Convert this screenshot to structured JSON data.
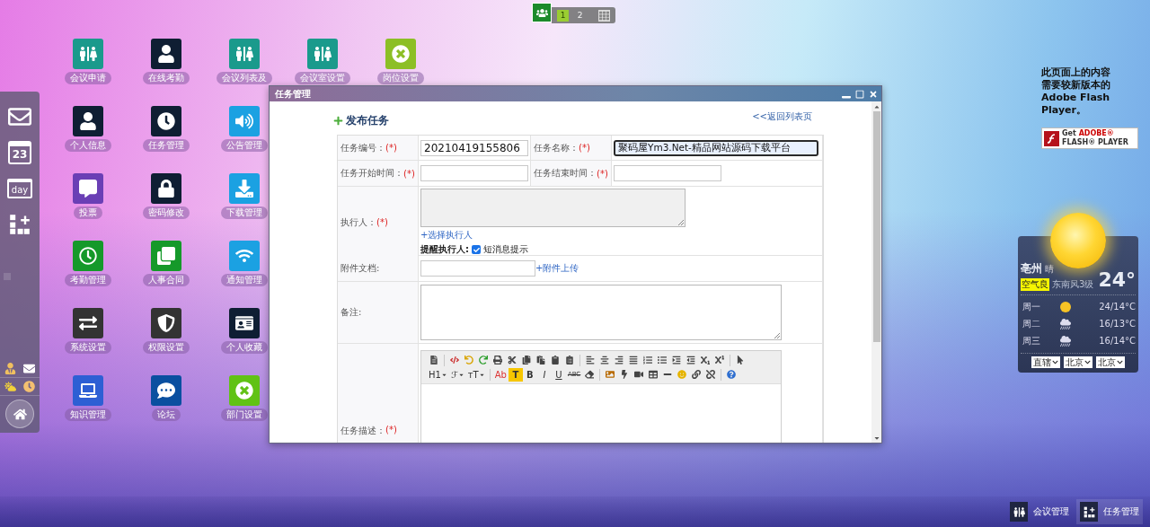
{
  "pager": {
    "pages": [
      {
        "label": "1",
        "selected": true
      },
      {
        "label": "2",
        "selected": false
      }
    ]
  },
  "desktop_icons": [
    {
      "icons": [
        {
          "label": "会议申请",
          "color": "#1a9a8c"
        },
        {
          "label": "在线考勤",
          "color": "#0f1e33"
        },
        {
          "label": "会议列表及",
          "color": "#1a9a8c"
        },
        {
          "label": "会议室设置",
          "color": "#1a9a8c"
        },
        {
          "label": "岗位设置",
          "color": "#8cbf26"
        }
      ]
    },
    {
      "icons": [
        {
          "label": "个人信息",
          "color": "#0f1e33"
        },
        {
          "label": "任务管理",
          "color": "#0f1e33"
        },
        {
          "label": "公告管理",
          "color": "#1ba1e2"
        }
      ]
    },
    {
      "icons": [
        {
          "label": "投票",
          "color": "#6a3fb5"
        },
        {
          "label": "密码修改",
          "color": "#0f1e33"
        },
        {
          "label": "下载管理",
          "color": "#1ba1e2"
        }
      ]
    },
    {
      "icons": [
        {
          "label": "考勤管理",
          "color": "#15992a"
        },
        {
          "label": "人事合同",
          "color": "#15992a"
        },
        {
          "label": "通知管理",
          "color": "#1ba1e2"
        }
      ]
    },
    {
      "icons": [
        {
          "label": "系统设置",
          "color": "#333333"
        },
        {
          "label": "权限设置",
          "color": "#333333"
        },
        {
          "label": "个人收藏",
          "color": "#0f1e33"
        }
      ]
    },
    {
      "icons": [
        {
          "label": "知识管理",
          "color": "#2d5fd4"
        },
        {
          "label": "论坛",
          "color": "#0a4fa0"
        },
        {
          "label": "部门设置",
          "color": "#61c215"
        }
      ]
    }
  ],
  "dock": {
    "calendar_date": "23",
    "day_label": "day"
  },
  "window": {
    "title": "任务管理",
    "heading": "发布任务",
    "back_link": "<<返回列表页",
    "form": {
      "rows": [
        {
          "kind": "pair",
          "fields": [
            {
              "label": "任务编号：",
              "mark": "(*)",
              "value": "20210419155806",
              "focused": false
            },
            {
              "label": "任务名称：",
              "mark": "(*)",
              "value": "聚码屋Ym3.Net-精品网站源码下载平台",
              "focused": true
            }
          ]
        },
        {
          "kind": "pair",
          "fields": [
            {
              "label": "任务开始时间：",
              "mark": "(*)",
              "focused": false
            },
            {
              "label": "任务结束时间：",
              "mark": "(*)",
              "focused": false
            }
          ]
        },
        {
          "kind": "assignee",
          "label": "执行人：",
          "mark": "(*)",
          "disabled": true,
          "link": "+选择执行人",
          "remind_label": "提醒执行人:",
          "option": {
            "label": "短消息提示",
            "checked": true
          }
        },
        {
          "kind": "upload",
          "label": "附件文档:",
          "link": "+附件上传"
        },
        {
          "kind": "textarea",
          "label": "备注:"
        },
        {
          "kind": "editor",
          "label": "任务描述：",
          "mark": "(*)",
          "toolbar": [
            [
              {
                "kind": "icon"
              },
              {
                "kind": "separator"
              },
              {
                "kind": "icon"
              },
              {
                "kind": "icon"
              },
              {
                "kind": "icon"
              },
              {
                "kind": "icon"
              },
              {
                "kind": "icon"
              },
              {
                "kind": "icon"
              },
              {
                "kind": "icon"
              },
              {
                "kind": "icon"
              },
              {
                "kind": "icon"
              },
              {
                "kind": "separator"
              },
              {
                "kind": "icon"
              },
              {
                "kind": "icon"
              },
              {
                "kind": "icon"
              },
              {
                "kind": "icon"
              },
              {
                "kind": "icon"
              },
              {
                "kind": "icon"
              },
              {
                "kind": "icon"
              },
              {
                "kind": "icon"
              },
              {
                "kind": "icon"
              },
              {
                "kind": "icon"
              },
              {
                "kind": "separator"
              },
              {
                "kind": "icon"
              }
            ],
            [
              {
                "kind": "dropdown",
                "label": "H1"
              },
              {
                "kind": "dropdown",
                "label": "ℱ"
              },
              {
                "kind": "dropdown",
                "label": "тT"
              },
              {
                "kind": "separator"
              },
              {
                "kind": "text",
                "label": "Ab"
              },
              {
                "kind": "text",
                "label": "T"
              },
              {
                "kind": "text",
                "label": "B"
              },
              {
                "kind": "text",
                "label": "I"
              },
              {
                "kind": "text",
                "label": "U"
              },
              {
                "kind": "text",
                "label": "ABC"
              },
              {
                "kind": "icon"
              },
              {
                "kind": "separator"
              },
              {
                "kind": "icon"
              },
              {
                "kind": "icon"
              },
              {
                "kind": "icon"
              },
              {
                "kind": "icon"
              },
              {
                "kind": "icon"
              },
              {
                "kind": "icon"
              },
              {
                "kind": "icon"
              },
              {
                "kind": "icon"
              },
              {
                "kind": "separator"
              },
              {
                "kind": "icon"
              }
            ]
          ]
        }
      ]
    }
  },
  "flash_notice": {
    "message": "此页面上的内容需要较新版本的Adobe Flash Player。",
    "badge_get": "Get",
    "badge_brand": "ADOBE®",
    "badge_product": "FLASH® PLAYER"
  },
  "weather": {
    "city": "亳州",
    "condition": "晴",
    "temperature": "24°",
    "air": "空气良",
    "wind": "东南风3级",
    "forecast": [
      {
        "day": "周一",
        "kind": "sun",
        "range": "24/14°C"
      },
      {
        "day": "周二",
        "kind": "rain",
        "range": "16/13°C"
      },
      {
        "day": "周三",
        "kind": "rain",
        "range": "16/14°C"
      }
    ],
    "selects": [
      "直辖",
      "北京",
      "北京"
    ]
  },
  "taskbar": [
    {
      "label": "会议管理",
      "selected": false
    },
    {
      "label": "任务管理",
      "selected": true
    }
  ]
}
